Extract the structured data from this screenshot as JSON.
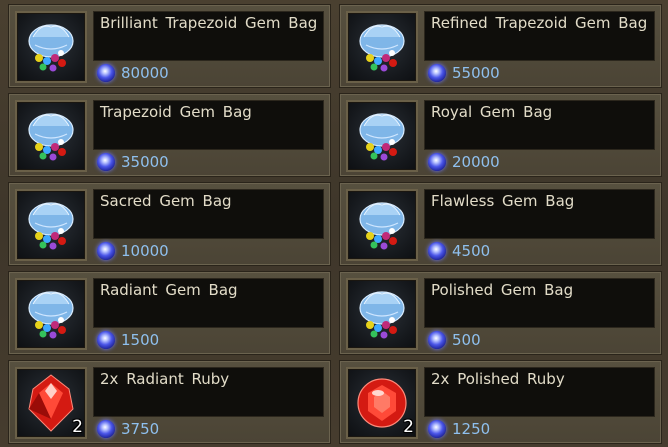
{
  "items": [
    {
      "name": "Brilliant Trapezoid Gem Bag",
      "price": "80000",
      "icon": "gem-bag-icon",
      "qty": ""
    },
    {
      "name": "Refined Trapezoid Gem Bag",
      "price": "55000",
      "icon": "gem-bag-icon",
      "qty": ""
    },
    {
      "name": "Trapezoid Gem Bag",
      "price": "35000",
      "icon": "gem-bag-icon",
      "qty": ""
    },
    {
      "name": "Royal Gem Bag",
      "price": "20000",
      "icon": "gem-bag-icon",
      "qty": ""
    },
    {
      "name": "Sacred Gem Bag",
      "price": "10000",
      "icon": "gem-bag-icon",
      "qty": ""
    },
    {
      "name": "Flawless Gem Bag",
      "price": "4500",
      "icon": "gem-bag-icon",
      "qty": ""
    },
    {
      "name": "Radiant Gem Bag",
      "price": "1500",
      "icon": "gem-bag-icon",
      "qty": ""
    },
    {
      "name": "Polished Gem Bag",
      "price": "500",
      "icon": "gem-bag-icon",
      "qty": ""
    },
    {
      "name": "2x Radiant Ruby",
      "price": "3750",
      "icon": "radiant-ruby-icon",
      "qty": "2"
    },
    {
      "name": "2x Polished Ruby",
      "price": "1250",
      "icon": "polished-ruby-icon",
      "qty": "2"
    }
  ],
  "currency_icon": "blood-shard-coin-icon",
  "colors": {
    "price": "#8fc0ee",
    "name": "#e2dcc8",
    "bag": "#7fb6e8",
    "ruby": "#d41a12"
  }
}
